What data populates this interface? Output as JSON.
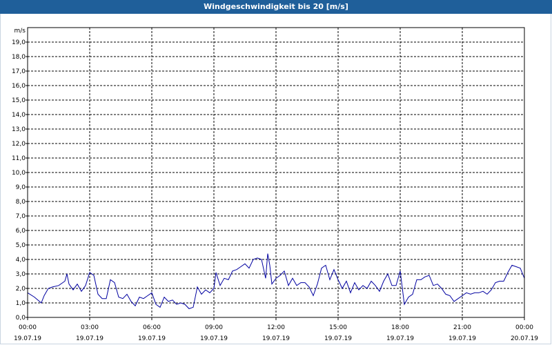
{
  "chart_data": {
    "type": "line",
    "title": "Windgeschwindigkeit bis 20 [m/s]",
    "ylabel": "m/s",
    "ylim": [
      0,
      20
    ],
    "yticks": [
      0,
      1,
      2,
      3,
      4,
      5,
      6,
      7,
      8,
      9,
      10,
      11,
      12,
      13,
      14,
      15,
      16,
      17,
      18,
      19
    ],
    "ytick_labels": [
      "0,0",
      "1,0",
      "2,0",
      "3,0",
      "4,0",
      "5,0",
      "6,0",
      "7,0",
      "8,0",
      "9,0",
      "10,0",
      "11,0",
      "12,0",
      "13,0",
      "14,0",
      "15,0",
      "16,0",
      "17,0",
      "18,0",
      "19,0"
    ],
    "xlim_hours": [
      0,
      24
    ],
    "xticks": [
      {
        "hour": 0,
        "time": "00:00",
        "date": "19.07.19"
      },
      {
        "hour": 3,
        "time": "03:00",
        "date": "19.07.19"
      },
      {
        "hour": 6,
        "time": "06:00",
        "date": "19.07.19"
      },
      {
        "hour": 9,
        "time": "09:00",
        "date": "19.07.19"
      },
      {
        "hour": 12,
        "time": "12:00",
        "date": "19.07.19"
      },
      {
        "hour": 15,
        "time": "15:00",
        "date": "19.07.19"
      },
      {
        "hour": 18,
        "time": "18:00",
        "date": "19.07.19"
      },
      {
        "hour": 21,
        "time": "21:00",
        "date": "19.07.19"
      },
      {
        "hour": 24,
        "time": "00:00",
        "date": "20.07.19"
      }
    ],
    "grid": true,
    "series": [
      {
        "color": "#0000a0",
        "x_hours": [
          0.0,
          0.33,
          0.66,
          0.8,
          1.0,
          1.2,
          1.5,
          1.8,
          1.9,
          2.0,
          2.2,
          2.4,
          2.6,
          2.8,
          3.0,
          3.2,
          3.4,
          3.6,
          3.8,
          4.0,
          4.2,
          4.4,
          4.6,
          4.8,
          5.0,
          5.2,
          5.4,
          5.6,
          5.8,
          6.0,
          6.2,
          6.4,
          6.6,
          6.8,
          7.0,
          7.2,
          7.4,
          7.6,
          7.8,
          8.0,
          8.2,
          8.4,
          8.6,
          8.8,
          9.0,
          9.1,
          9.3,
          9.5,
          9.7,
          9.9,
          10.1,
          10.3,
          10.5,
          10.7,
          10.9,
          11.1,
          11.3,
          11.5,
          11.6,
          11.7,
          11.8,
          12.0,
          12.2,
          12.4,
          12.6,
          12.8,
          13.0,
          13.2,
          13.4,
          13.6,
          13.8,
          14.0,
          14.2,
          14.4,
          14.6,
          14.8,
          15.0,
          15.2,
          15.4,
          15.6,
          15.8,
          16.0,
          16.2,
          16.4,
          16.6,
          16.8,
          17.0,
          17.2,
          17.4,
          17.6,
          17.8,
          18.0,
          18.2,
          18.4,
          18.6,
          18.8,
          19.0,
          19.2,
          19.4,
          19.6,
          19.8,
          20.0,
          20.2,
          20.4,
          20.6,
          20.8,
          21.0,
          21.2,
          21.4,
          21.6,
          21.8,
          22.0,
          22.2,
          22.4,
          22.6,
          22.8,
          23.0,
          23.2,
          23.4,
          23.6,
          23.8,
          24.0
        ],
        "values": [
          1.7,
          1.4,
          1.0,
          1.5,
          2.0,
          2.1,
          2.2,
          2.5,
          3.0,
          2.3,
          1.9,
          2.3,
          1.8,
          2.2,
          3.1,
          2.9,
          1.6,
          1.3,
          1.3,
          2.6,
          2.4,
          1.4,
          1.3,
          1.6,
          1.1,
          0.8,
          1.4,
          1.3,
          1.5,
          1.7,
          0.9,
          0.7,
          1.4,
          1.1,
          1.2,
          0.9,
          1.0,
          0.9,
          0.6,
          0.7,
          2.1,
          1.6,
          1.9,
          1.7,
          2.0,
          3.1,
          2.2,
          2.7,
          2.6,
          3.2,
          3.3,
          3.5,
          3.7,
          3.4,
          4.0,
          4.1,
          4.0,
          2.7,
          4.4,
          3.6,
          2.3,
          2.7,
          2.9,
          3.2,
          2.2,
          2.7,
          2.2,
          2.4,
          2.4,
          2.1,
          1.5,
          2.3,
          3.4,
          3.6,
          2.6,
          3.3,
          2.6,
          2.0,
          2.5,
          1.7,
          2.4,
          1.9,
          2.2,
          2.0,
          2.5,
          2.2,
          1.8,
          2.5,
          3.0,
          2.2,
          2.2,
          3.2,
          0.9,
          1.4,
          1.6,
          2.6,
          2.6,
          2.8,
          2.9,
          2.2,
          2.3,
          2.0,
          1.6,
          1.5,
          1.1,
          1.3,
          1.5,
          1.7,
          1.6,
          1.7,
          1.7,
          1.8,
          1.6,
          1.9,
          2.4,
          2.5,
          2.5,
          3.1,
          3.6,
          3.5,
          3.4,
          2.7,
          2.5,
          1.7
        ]
      }
    ]
  }
}
